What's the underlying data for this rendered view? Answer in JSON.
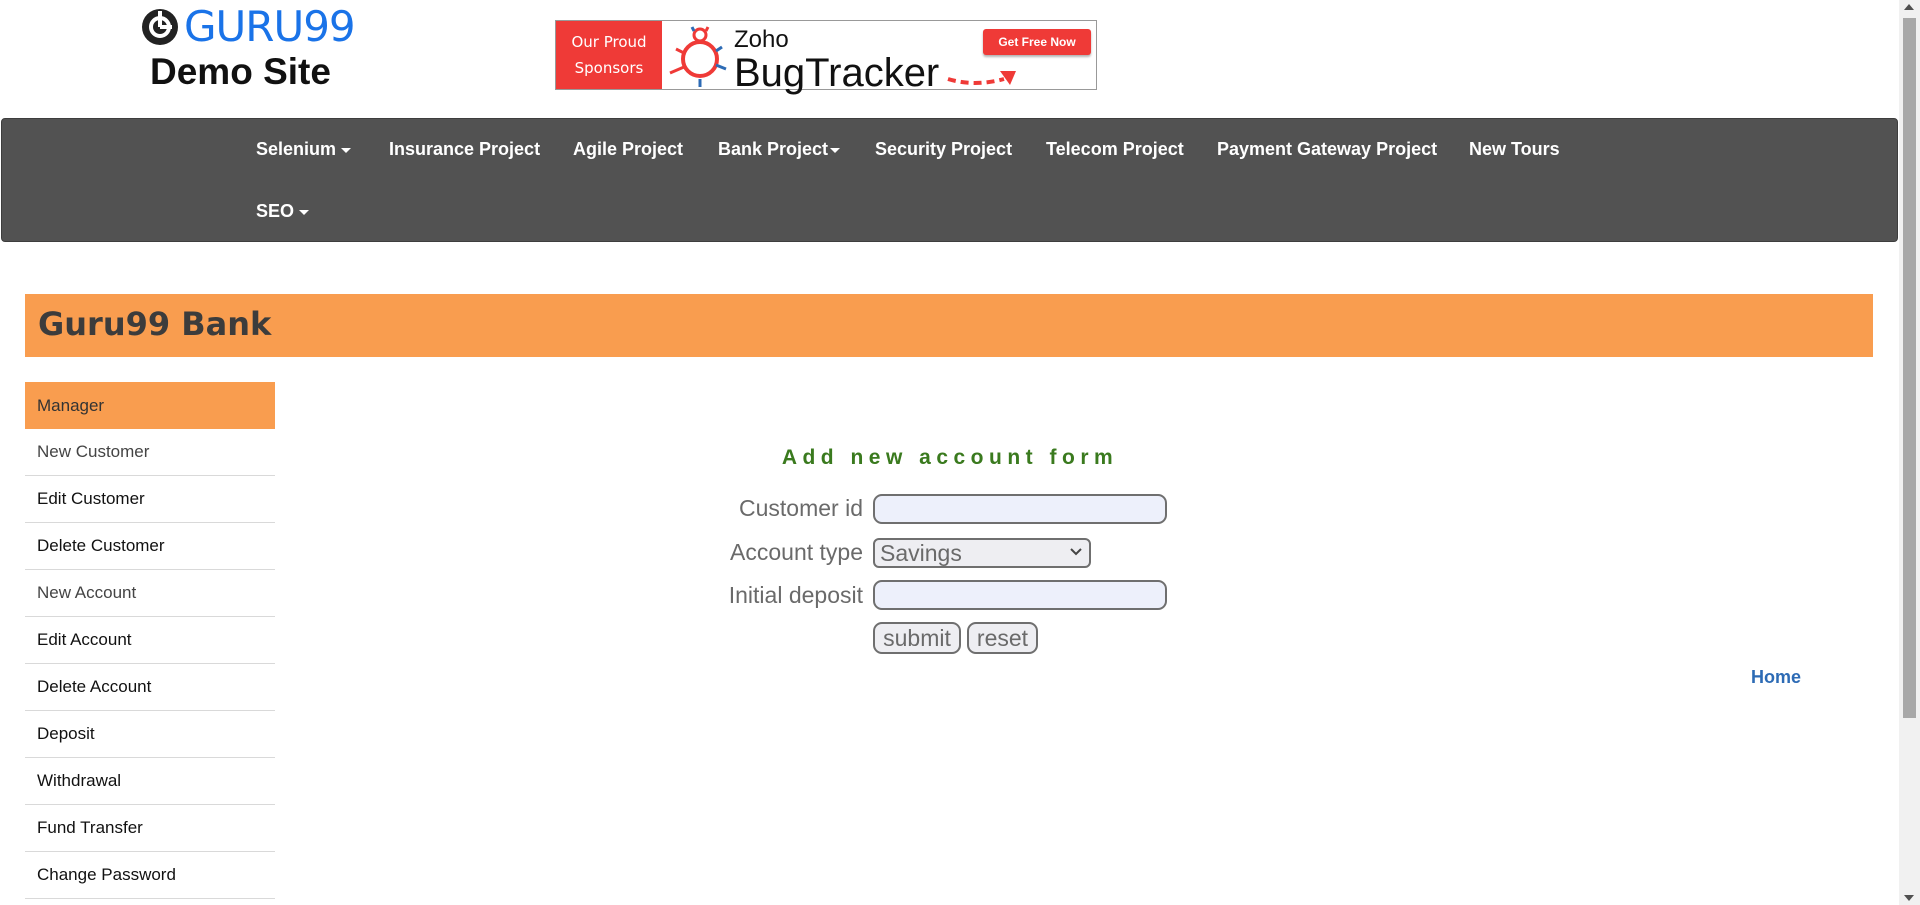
{
  "header": {
    "logo_word": "GURU99",
    "logo_sub": "Demo Site"
  },
  "sponsor": {
    "line1": "Our Proud",
    "line2": "Sponsors",
    "zoho": "Zoho",
    "product": "BugTracker",
    "cta": "Get Free Now"
  },
  "nav": {
    "items": [
      {
        "label": "Selenium",
        "dropdown": true
      },
      {
        "label": "Insurance Project",
        "dropdown": false
      },
      {
        "label": "Agile Project",
        "dropdown": false
      },
      {
        "label": "Bank Project",
        "dropdown": true
      },
      {
        "label": "Security Project",
        "dropdown": false
      },
      {
        "label": "Telecom Project",
        "dropdown": false
      },
      {
        "label": "Payment Gateway Project",
        "dropdown": false
      },
      {
        "label": "New Tours",
        "dropdown": false
      },
      {
        "label": "SEO",
        "dropdown": true
      }
    ]
  },
  "bank": {
    "title": "Guru99 Bank"
  },
  "sidebar": {
    "items": [
      {
        "label": "Manager"
      },
      {
        "label": "New Customer"
      },
      {
        "label": "Edit Customer"
      },
      {
        "label": "Delete Customer"
      },
      {
        "label": "New Account"
      },
      {
        "label": "Edit Account"
      },
      {
        "label": "Delete Account"
      },
      {
        "label": "Deposit"
      },
      {
        "label": "Withdrawal"
      },
      {
        "label": "Fund Transfer"
      },
      {
        "label": "Change Password"
      }
    ]
  },
  "form": {
    "title": "Add new account form",
    "customer_id_label": "Customer id",
    "customer_id_value": "",
    "account_type_label": "Account type",
    "account_type_value": "Savings",
    "initial_deposit_label": "Initial deposit",
    "initial_deposit_value": "",
    "submit_label": "submit",
    "reset_label": "reset"
  },
  "home_link": "Home",
  "colors": {
    "accent_orange": "#f99d4f",
    "nav_bg": "#525252",
    "logo_blue": "#1a73e8",
    "form_title_green": "#3a7a1e",
    "link_blue": "#2d6bb5",
    "sponsor_red": "#ef3a37"
  }
}
